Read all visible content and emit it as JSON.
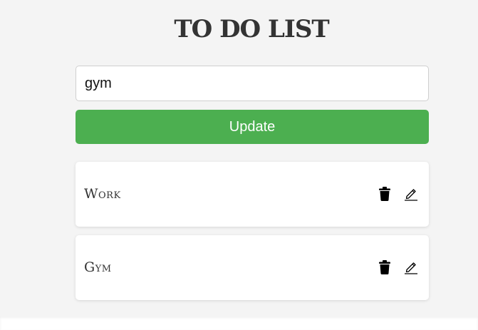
{
  "header": {
    "title": "TO DO LIST"
  },
  "form": {
    "input_value": "gym",
    "update_label": "Update"
  },
  "todos": [
    {
      "text": "Work",
      "delete_icon": "trash-icon",
      "edit_icon": "pencil-icon"
    },
    {
      "text": "Gym",
      "delete_icon": "trash-icon",
      "edit_icon": "pencil-icon"
    }
  ],
  "colors": {
    "accent": "#4caf50",
    "background": "#f4f4f4",
    "card": "#ffffff",
    "title": "#333333"
  }
}
